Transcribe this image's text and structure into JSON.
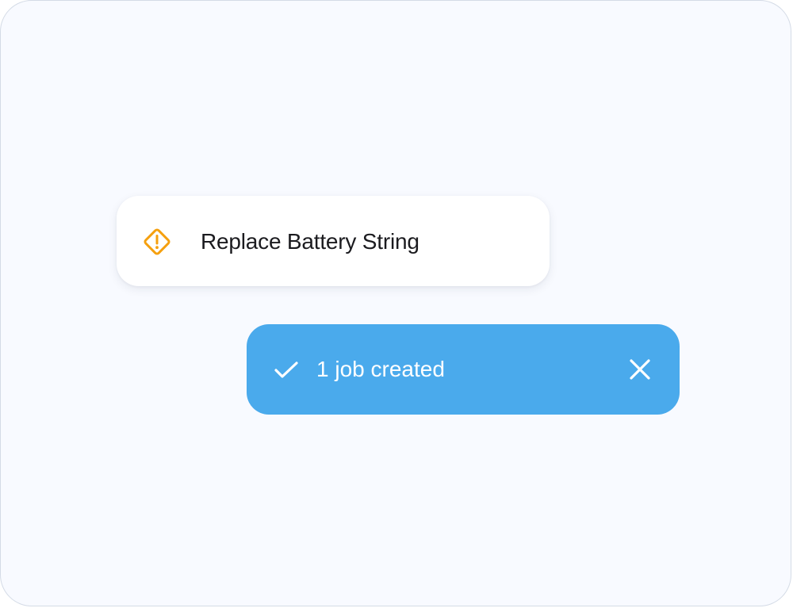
{
  "task_card": {
    "title": "Replace Battery String",
    "icon": "warning-diamond-icon",
    "icon_color": "#f5a00f"
  },
  "toast": {
    "message": "1 job created",
    "status_icon": "check-icon",
    "close_icon": "close-icon",
    "background_color": "#4aaaec"
  }
}
